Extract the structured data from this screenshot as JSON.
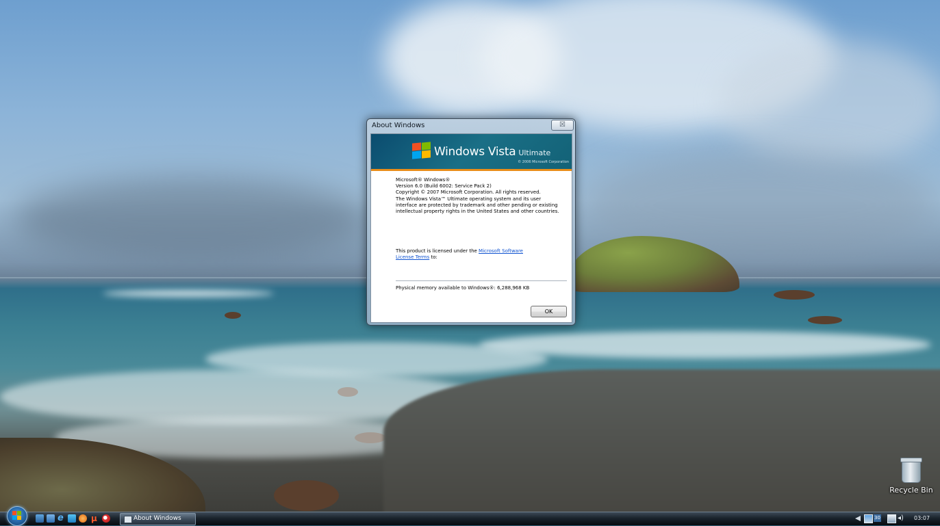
{
  "dialog": {
    "title": "About Windows",
    "close_glyph": "☒",
    "banner": {
      "brand_main": "Windows Vista",
      "brand_sub": "Ultimate",
      "copyright": "© 2006 Microsoft Corporation"
    },
    "info": {
      "line1": "Microsoft® Windows®",
      "line2": "Version 6.0 (Build 6002: Service Pack 2)",
      "line3": "Copyright © 2007 Microsoft Corporation.  All rights reserved.",
      "paragraph": "The Windows Vista™ Ultimate operating system and its user interface are protected by trademark and other pending or existing intellectual property rights in the United States and other countries."
    },
    "license": {
      "prefix": "This product is licensed under the ",
      "link1": "Microsoft Software",
      "link2": "License Terms",
      "suffix": " to:"
    },
    "memory": "Physical memory available to Windows®: 6,288,968 KB",
    "ok_label": "OK"
  },
  "desktop": {
    "recycle_bin_label": "Recycle Bin"
  },
  "taskbar": {
    "quick_launch": [
      "show-desktop-icon",
      "switch-windows-icon",
      "internet-explorer-icon",
      "windows-media-icon",
      "firefox-icon",
      "utorrent-icon",
      "opera-icon"
    ],
    "task_button_label": "About Windows",
    "tray": {
      "clock": "03:07",
      "badge": "30"
    }
  },
  "colors": {
    "banner_accent": "#e98d1a",
    "banner_bg": "#0b4c6f",
    "link": "#0e52d0"
  }
}
